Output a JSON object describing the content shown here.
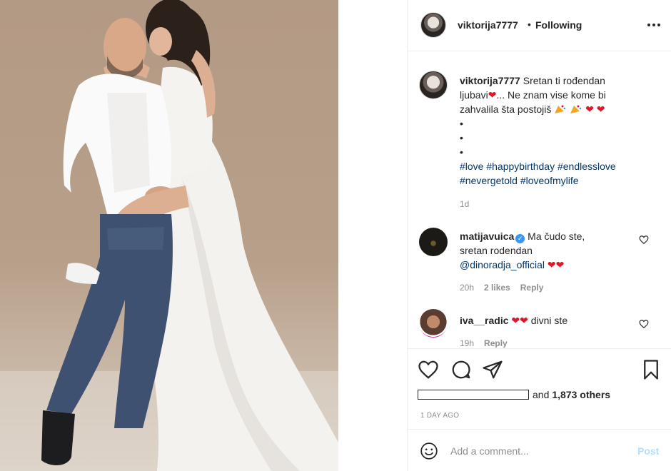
{
  "post": {
    "image_alt": "photo of a couple",
    "author": "viktorija7777",
    "follow_status": "Following",
    "separator": "•"
  },
  "caption": {
    "username": "viktorija7777",
    "line1": "Sretan ti rođendan",
    "line2_text": "ljubavi",
    "line2_after": "... Ne znam vise kome bi",
    "line3_text": "zahvalila šta postojiš",
    "bullets": [
      "•",
      "•",
      "•"
    ],
    "hashtags_line1": "#love #happybirthday #endlesslove",
    "hashtags_line2": "#nevergetold #loveofmylife",
    "time": "1d",
    "heart": "❤"
  },
  "comments": [
    {
      "username": "matijavuica",
      "verified": true,
      "verified_glyph": "✓",
      "text_line1": "Ma čudo ste,",
      "text_line2": "sretan rodendan",
      "mention": "@dinoradja_official",
      "emoji": "❤❤",
      "time": "20h",
      "likes": "2 likes",
      "reply": "Reply"
    },
    {
      "username": "iva__radic",
      "emoji": "❤❤",
      "text": "divni ste",
      "time": "19h",
      "reply": "Reply"
    }
  ],
  "actions": {
    "likes_suffix": "and",
    "likes_count": "1,873 others",
    "date": "1 DAY AGO"
  },
  "add_comment": {
    "placeholder": "Add a comment...",
    "post_label": "Post"
  },
  "colors": {
    "link": "#00376b",
    "heart": "#e0162b",
    "post_disabled": "#b2dffc",
    "muted": "#8e8e8e"
  }
}
